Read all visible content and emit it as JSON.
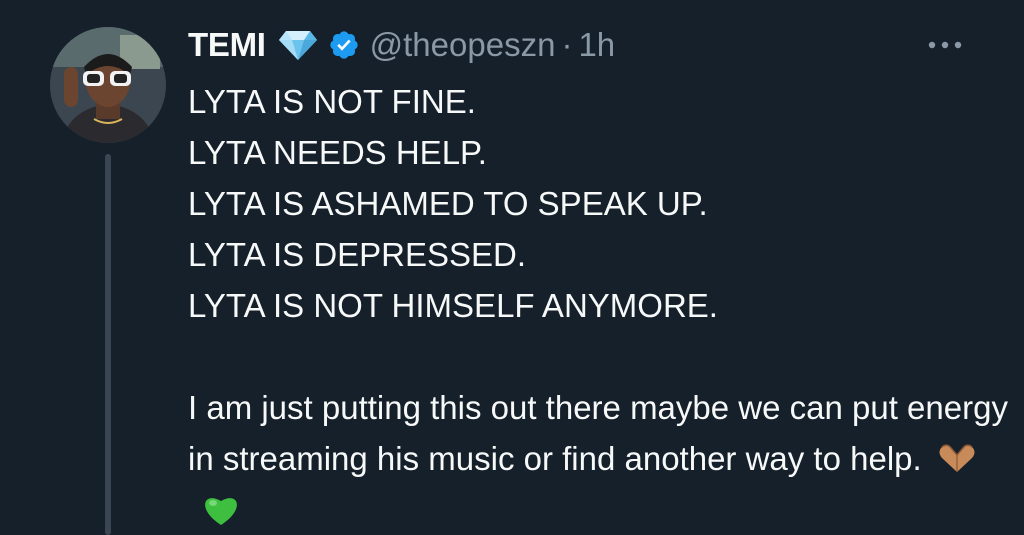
{
  "author": {
    "name": "TEMI",
    "handle": "@theopeszn",
    "separator": "·",
    "time": "1h",
    "badges": [
      "diamond-icon",
      "verified-icon"
    ]
  },
  "tweet": {
    "lines": [
      "LYTA IS NOT FINE.",
      "LYTA NEEDS HELP.",
      "LYTA IS ASHAMED TO SPEAK UP.",
      "LYTA IS DEPRESSED.",
      "LYTA IS NOT HIMSELF ANYMORE."
    ],
    "paragraph": "I am just putting this out there maybe we can put energy in streaming his music or find another way to help.",
    "emojis": [
      "heart-hands-icon",
      "green-heart-icon"
    ]
  },
  "colors": {
    "background": "#15202b",
    "text": "#f7f9f9",
    "muted": "#8b98a5",
    "verified": "#1d9bf0",
    "thread_line": "#3a4652"
  }
}
